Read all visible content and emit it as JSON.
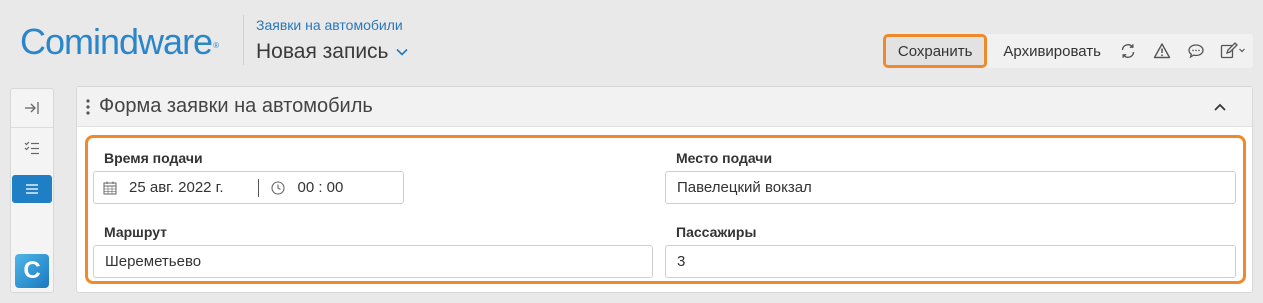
{
  "app": {
    "logo_text": "Comindware",
    "logo_mark": "®"
  },
  "header": {
    "breadcrumb": "Заявки на автомобили",
    "record_title": "Новая запись"
  },
  "toolbar": {
    "save_label": "Сохранить",
    "archive_label": "Архивировать",
    "icons": [
      "refresh-icon",
      "warning-icon",
      "comment-icon",
      "edit-icon"
    ],
    "accent_color": "#ef8a2a"
  },
  "sidebar": {
    "items": [
      "collapse-panel-icon",
      "checklist-icon",
      "list-icon"
    ],
    "active_item": "list-icon",
    "logo_letter": "C"
  },
  "form": {
    "title": "Форма заявки на автомобиль",
    "fields": {
      "pickup_time": {
        "label": "Время подачи",
        "date": "25 авг. 2022 г.",
        "time": "00 : 00"
      },
      "pickup_place": {
        "label": "Место подачи",
        "value": "Павелецкий вокзал"
      },
      "route": {
        "label": "Маршрут",
        "value": "Шереметьево"
      },
      "passengers": {
        "label": "Пассажиры",
        "value": "3"
      }
    }
  }
}
